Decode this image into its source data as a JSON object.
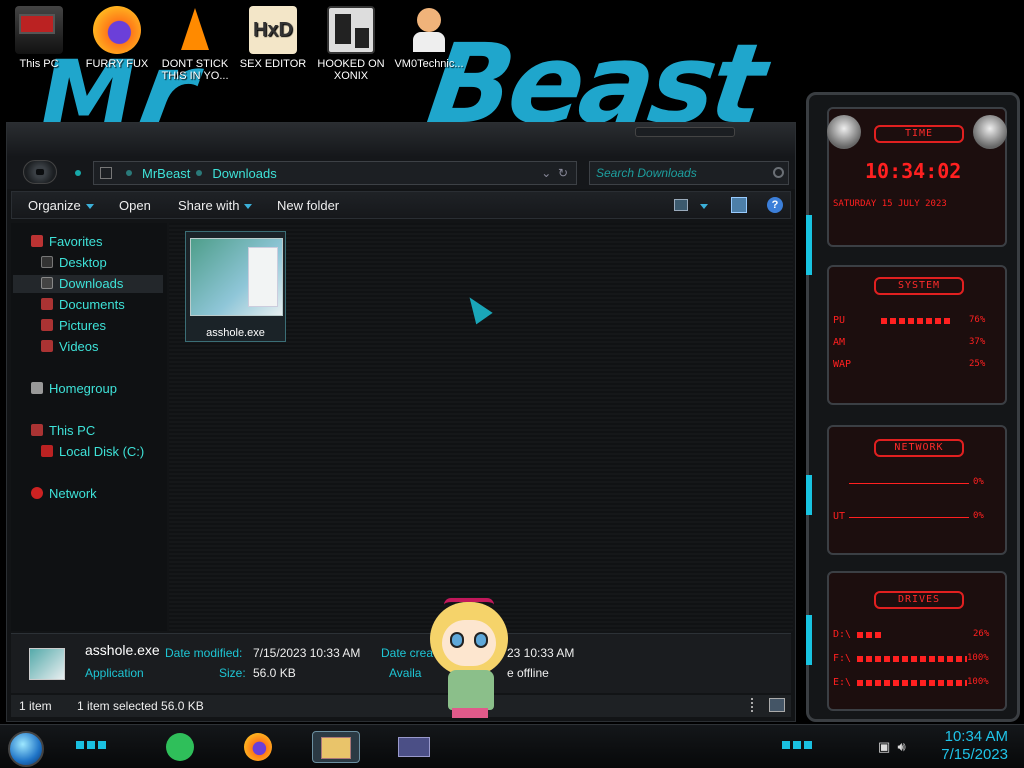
{
  "desktop": {
    "icons": [
      {
        "label": "This PC"
      },
      {
        "label": "FURRY FUX"
      },
      {
        "label": "DONT STICK THIS IN YO..."
      },
      {
        "label": "SEX EDITOR"
      },
      {
        "label": "HOOKED ON XONIX"
      },
      {
        "label": "VM0Technic..."
      }
    ]
  },
  "explorer": {
    "address": {
      "root": "MrBeast",
      "folder": "Downloads"
    },
    "search_placeholder": "Search Downloads",
    "toolbar": {
      "organize": "Organize",
      "open": "Open",
      "share_with": "Share with",
      "new_folder": "New folder"
    },
    "sidebar": {
      "favorites": "Favorites",
      "desktop": "Desktop",
      "downloads": "Downloads",
      "documents": "Documents",
      "pictures": "Pictures",
      "videos": "Videos",
      "homegroup": "Homegroup",
      "this_pc": "This PC",
      "local_disk": "Local Disk (C:)",
      "network": "Network"
    },
    "files": [
      {
        "name": "asshole.exe"
      }
    ],
    "details": {
      "filename": "asshole.exe",
      "type": "Application",
      "date_modified_label": "Date modified:",
      "date_modified": "7/15/2023 10:33 AM",
      "size_label": "Size:",
      "size": "56.0 KB",
      "date_created_label": "Date crea",
      "date_created": "23 10:33 AM",
      "availability_label": "Availa",
      "availability": "e offline"
    },
    "status": {
      "count": "1 item",
      "selected": "1 item selected  56.0 KB"
    }
  },
  "gadget": {
    "time_title": "TIME",
    "time": "10:34:02",
    "date": "SATURDAY 15 JULY 2023",
    "system_title": "SYSTEM",
    "system": [
      {
        "label": "PU",
        "value": "76%"
      },
      {
        "label": "AM",
        "value": "37%"
      },
      {
        "label": "WAP",
        "value": "25%"
      }
    ],
    "network_title": "NETWORK",
    "network": [
      {
        "label": "",
        "value": "0%"
      },
      {
        "label": "UT",
        "value": "0%"
      }
    ],
    "drives_title": "DRIVES",
    "drives": [
      {
        "label": "D:\\",
        "value": "26%"
      },
      {
        "label": "F:\\",
        "value": "100%"
      },
      {
        "label": "E:\\",
        "value": "100%"
      }
    ]
  },
  "taskbar": {
    "time": "10:34 AM",
    "date": "7/15/2023"
  },
  "colors": {
    "accent": "#3ee2d8",
    "gadget_red": "#ff2020",
    "clock": "#1fc3e8"
  }
}
